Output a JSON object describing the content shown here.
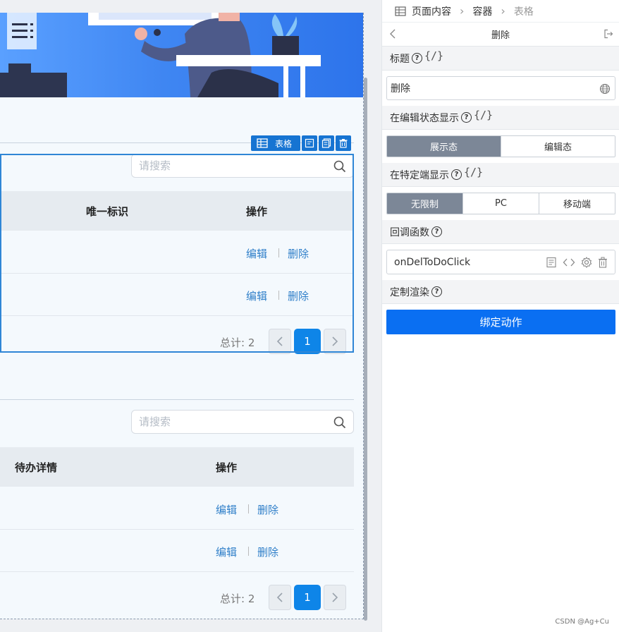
{
  "canvas": {
    "table1": {
      "search_placeholder": "请搜索",
      "columns": [
        "唯一标识",
        "操作"
      ],
      "rows": [
        {
          "edit": "编辑",
          "delete": "删除"
        },
        {
          "edit": "编辑",
          "delete": "删除"
        }
      ],
      "total_text": "总计: 2",
      "current_page": "1"
    },
    "table2": {
      "search_placeholder": "请搜索",
      "columns": [
        "待办详情",
        "操作"
      ],
      "rows": [
        {
          "edit": "编辑",
          "delete": "删除"
        },
        {
          "edit": "编辑",
          "delete": "删除"
        }
      ],
      "total_text": "总计: 2",
      "current_page": "1"
    },
    "selection_toolbar": {
      "label": "表格"
    }
  },
  "panel": {
    "breadcrumb": [
      "页面内容",
      "容器",
      "表格"
    ],
    "title": "删除",
    "sections": {
      "title": {
        "label": "标题",
        "value": "删除"
      },
      "edit_state": {
        "label": "在编辑状态显示",
        "options": [
          "展示态",
          "编辑态"
        ],
        "active": 0
      },
      "terminal": {
        "label": "在特定端显示",
        "options": [
          "无限制",
          "PC",
          "移动端"
        ],
        "active": 0
      },
      "callback": {
        "label": "回调函数",
        "value": "onDelToDoClick"
      },
      "custom_render": {
        "label": "定制渲染"
      }
    },
    "q_mark": "?",
    "code_mark": "{/}",
    "bind_button": "绑定动作"
  },
  "watermark": "CSDN @Ag+Cu",
  "colors": {
    "accent": "#0a6ff2",
    "selection": "#2f86d6",
    "link": "#2f7fc9",
    "segment_active": "#7c8797"
  }
}
